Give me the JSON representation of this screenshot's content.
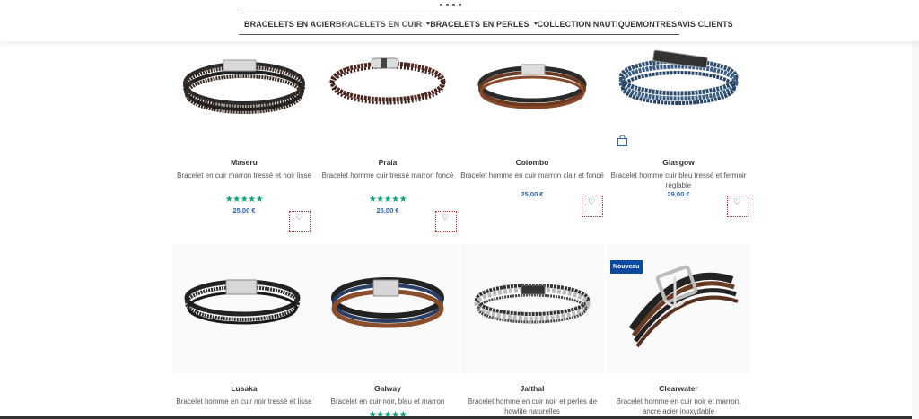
{
  "nav": {
    "items": [
      {
        "label": "BRACELETS EN ACIER",
        "has_caret": false
      },
      {
        "label": "BRACELETS EN CUIR",
        "has_caret": true
      },
      {
        "label": "BRACELETS EN PERLES",
        "has_caret": true
      },
      {
        "label": "COLLECTION NAUTIQUE",
        "has_caret": false
      },
      {
        "label": "MONTRES",
        "has_caret": false
      },
      {
        "label": "AVIS CLIENTS",
        "has_caret": false
      }
    ]
  },
  "products": [
    {
      "name": "Maseru",
      "desc": "Bracelet en cuir marron tressé et noir lisse",
      "rating_stars": "★★★★★",
      "rating": 5,
      "price": "25,00 €"
    },
    {
      "name": "Praia",
      "desc": "Bracelet homme cuir tressé marron foncé",
      "rating_stars": "★★★★★",
      "rating": 5,
      "price": "25,00 €"
    },
    {
      "name": "Colombo",
      "desc": "Bracelet homme en cuir marron clair et foncé",
      "price": "25,00 €"
    },
    {
      "name": "Glasgow",
      "desc": "Bracelet homme cuir bleu tressé et fermoir réglable",
      "price": "29,00 €"
    },
    {
      "name": "Lusaka",
      "desc": "Bracelet homme en cuir noir tressé et lisse"
    },
    {
      "name": "Galway",
      "desc": "Bracelet en cuir noir, bleu et marron",
      "rating_stars": "★★★★★",
      "rating": 5
    },
    {
      "name": "Jalthal",
      "desc": "Bracelet homme en cuir noir et perles de howlite naturelles"
    },
    {
      "name": "Clearwater",
      "desc": "Bracelet homme en cuir noir et marron, ancre acier inoxydable",
      "badge": "Nouveau"
    }
  ],
  "colors": {
    "accent": "#2a64a8",
    "stars": "#12a37a",
    "badge": "#0c4aa0"
  },
  "icons": {
    "wishlist": "heart-icon",
    "cart": "shopping-bag-icon",
    "dropdown": "caret-down-icon"
  }
}
